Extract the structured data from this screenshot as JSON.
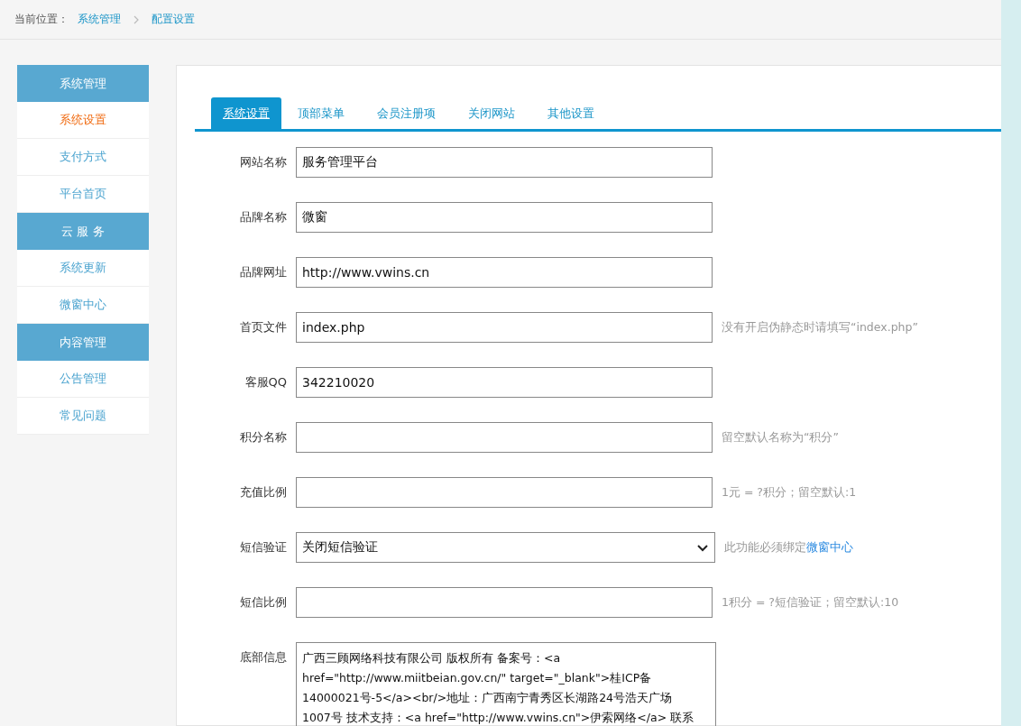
{
  "breadcrumb": {
    "label": "当前位置：",
    "items": [
      "系统管理",
      "配置设置"
    ]
  },
  "sidebar": [
    {
      "kind": "header",
      "label": "系统管理"
    },
    {
      "kind": "item",
      "label": "系统设置",
      "selected": true
    },
    {
      "kind": "item",
      "label": "支付方式",
      "selected": false
    },
    {
      "kind": "item",
      "label": "平台首页",
      "selected": false
    },
    {
      "kind": "header",
      "label": "云 服 务"
    },
    {
      "kind": "item",
      "label": "系统更新",
      "selected": false
    },
    {
      "kind": "item",
      "label": "微窗中心",
      "selected": false
    },
    {
      "kind": "header",
      "label": "内容管理"
    },
    {
      "kind": "item",
      "label": "公告管理",
      "selected": false
    },
    {
      "kind": "item",
      "label": "常见问题",
      "selected": false
    }
  ],
  "tabs": [
    {
      "label": "系统设置",
      "selected": true
    },
    {
      "label": "顶部菜单",
      "selected": false
    },
    {
      "label": "会员注册项",
      "selected": false
    },
    {
      "label": "关闭网站",
      "selected": false
    },
    {
      "label": "其他设置",
      "selected": false
    }
  ],
  "fields": [
    {
      "kind": "text",
      "label": "网站名称",
      "value": "服务管理平台"
    },
    {
      "kind": "text",
      "label": "品牌名称",
      "value": "微窗"
    },
    {
      "kind": "text",
      "label": "品牌网址",
      "value": "http://www.vwins.cn"
    },
    {
      "kind": "text",
      "label": "首页文件",
      "value": "index.php",
      "hint": "没有开启伪静态时请填写“index.php”"
    },
    {
      "kind": "text",
      "label": "客服QQ",
      "value": "342210020"
    },
    {
      "kind": "text",
      "label": "积分名称",
      "hint": "留空默认名称为“积分”"
    },
    {
      "kind": "text",
      "label": "充值比例",
      "hint": "1元 = ?积分；留空默认:1"
    },
    {
      "kind": "select",
      "label": "短信验证",
      "value": "关闭短信验证",
      "hint": "此功能必须绑定",
      "hint_link": "微窗中心"
    },
    {
      "kind": "text",
      "label": "短信比例",
      "hint": "1积分 = ?短信验证；留空默认:10"
    },
    {
      "kind": "textarea",
      "label": "底部信息",
      "lines": [
        "广西三顾网络科技有限公司 版权所有 备案号：<a",
        "href=\"http://www.miitbeian.gov.cn/\" target=\"_blank\">桂ICP备",
        "14000021号-5</a><br/>地址：广西南宁青秀区长湖路24号浩天广场",
        "1007号 技术支持：<a href=\"http://www.vwins.cn\">伊索网络</a> 联系"
      ]
    }
  ]
}
